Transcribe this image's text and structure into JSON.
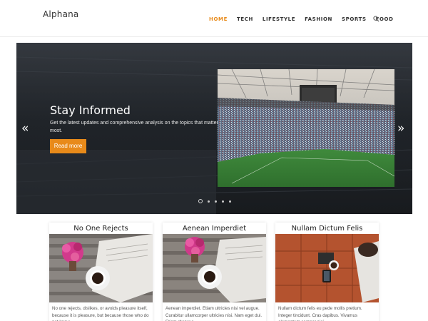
{
  "site": {
    "logo": "Alphana"
  },
  "nav": {
    "items": [
      {
        "label": "HOME",
        "active": true
      },
      {
        "label": "TECH",
        "active": false
      },
      {
        "label": "LIFESTYLE",
        "active": false
      },
      {
        "label": "FASHION",
        "active": false
      },
      {
        "label": "SPORTS",
        "active": false
      },
      {
        "label": "FOOD",
        "active": false
      }
    ],
    "search_icon": "search-icon"
  },
  "hero": {
    "title": "Stay Informed",
    "description": "Get the latest updates and comprehensive analysis on the topics that matter most.",
    "button_label": "Read more",
    "prev_arrow": "«",
    "next_arrow": "»",
    "slide_count": 5,
    "active_slide": 1
  },
  "cards": [
    {
      "title": "No One Rejects",
      "text": "No one rejects, dislikes, or avoids pleasure itself, because it is pleasure, but because those who do not know"
    },
    {
      "title": "Aenean Imperdiet",
      "text": "Aenean imperdiet. Etiam ultricies nisi vel augue. Curabitur ullamcorper ultricies nisi. Nam eget dui. Etiam rhoncus"
    },
    {
      "title": "Nullam Dictum Felis",
      "text": "Nullam dictum felis eu pede mollis pretium. Integer tincidunt. Cras dapibus. Vivamus elementum semper nisi"
    }
  ],
  "colors": {
    "accent": "#e88a1a",
    "hero_bg": "#1f2328",
    "text": "#333333"
  }
}
